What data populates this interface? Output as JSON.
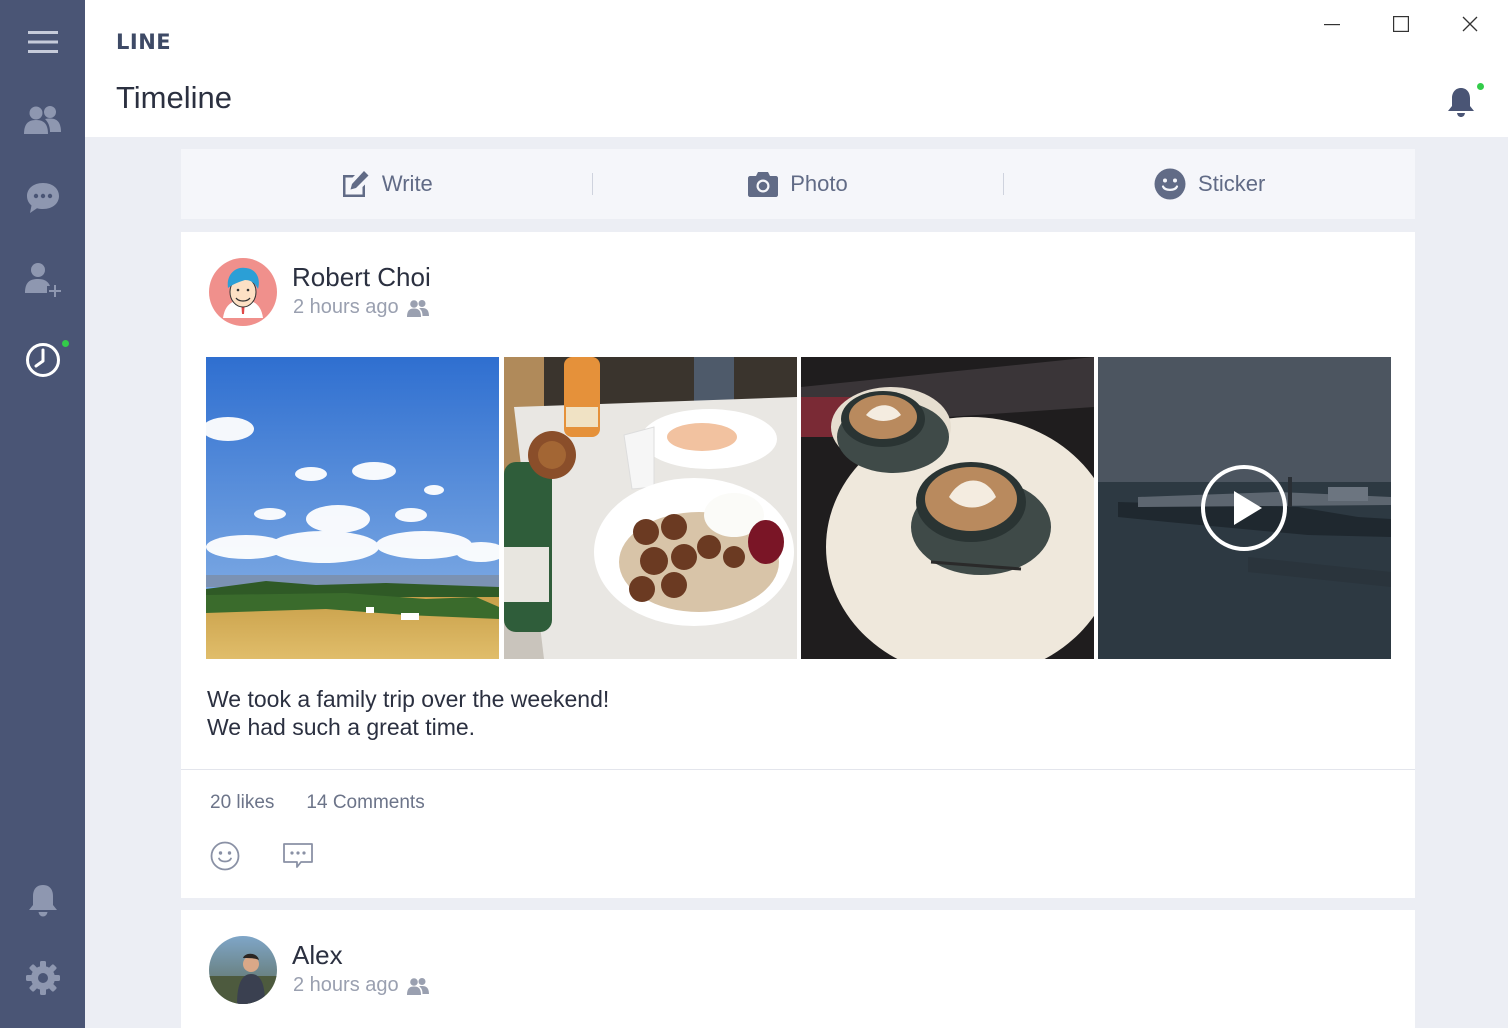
{
  "app": {
    "brand": "LINE",
    "title": "Timeline"
  },
  "composer": {
    "write": "Write",
    "photo": "Photo",
    "sticker": "Sticker"
  },
  "posts": [
    {
      "author": "Robert Choi",
      "time": "2 hours ago",
      "text_line1": "We took a family trip over the weekend!",
      "text_line2": "We had such a great time.",
      "likes": "20 likes",
      "comments": "14 Comments"
    },
    {
      "author": "Alex",
      "time": "2 hours ago"
    }
  ],
  "colors": {
    "sidebar": "#4a5575",
    "accent_dot": "#33cc4a",
    "icon": "#616b86",
    "background": "#eceef4"
  },
  "icons": [
    "menu-icon",
    "friends-icon",
    "chat-icon",
    "add-friend-icon",
    "timeline-clock-icon",
    "bell-icon",
    "gear-icon",
    "edit-icon",
    "camera-icon",
    "smiley-icon",
    "comment-icon",
    "play-icon",
    "group-icon"
  ]
}
